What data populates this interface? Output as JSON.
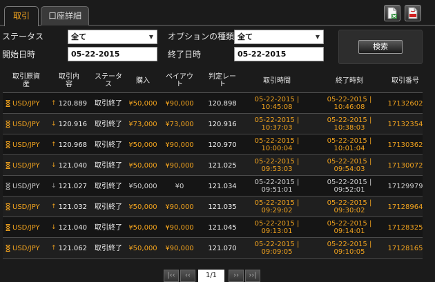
{
  "tabs": {
    "active": "取引",
    "inactive": "口座詳細"
  },
  "filter": {
    "status_label": "ステータス",
    "status_value": "全て",
    "option_type_label": "オプションの種類",
    "option_type_value": "全て",
    "start_date_label": "開始日時",
    "start_date_value": "05-22-2015",
    "end_date_label": "終了日時",
    "end_date_value": "05-22-2015",
    "search_label": "検索"
  },
  "table": {
    "headers": [
      "取引原資産",
      "取引内容",
      "ステータス",
      "購入",
      "ペイアウト",
      "判定レート",
      "取引時間",
      "終了時刻",
      "取引番号"
    ],
    "rows": [
      {
        "asset": "USD/JPY",
        "dir": "↑",
        "rate": "120.889",
        "status": "取引終了",
        "purchase": "¥50,000",
        "payout": "¥90,000",
        "judge": "120.898",
        "time1": "05-22-2015 |",
        "time2": "10:45:08",
        "end1": "05-22-2015 |",
        "end2": "10:46:08",
        "id": "17132602"
      },
      {
        "asset": "USD/JPY",
        "dir": "↓",
        "rate": "120.916",
        "status": "取引終了",
        "purchase": "¥73,000",
        "payout": "¥73,000",
        "judge": "120.916",
        "time1": "05-22-2015 |",
        "time2": "10:37:03",
        "end1": "05-22-2015 |",
        "end2": "10:38:03",
        "id": "17132354"
      },
      {
        "asset": "USD/JPY",
        "dir": "↑",
        "rate": "120.968",
        "status": "取引終了",
        "purchase": "¥50,000",
        "payout": "¥90,000",
        "judge": "120.970",
        "time1": "05-22-2015 |",
        "time2": "10:00:04",
        "end1": "05-22-2015 |",
        "end2": "10:01:04",
        "id": "17130362"
      },
      {
        "asset": "USD/JPY",
        "dir": "↓",
        "rate": "121.040",
        "status": "取引終了",
        "purchase": "¥50,000",
        "payout": "¥90,000",
        "judge": "121.025",
        "time1": "05-22-2015 |",
        "time2": "09:53:03",
        "end1": "05-22-2015 |",
        "end2": "09:54:03",
        "id": "17130072"
      },
      {
        "asset": "USD/JPY",
        "dir": "↓",
        "rate": "121.027",
        "status": "取引終了",
        "purchase": "¥50,000",
        "payout": "¥0",
        "judge": "121.034",
        "time1": "05-22-2015 |",
        "time2": "09:51:01",
        "end1": "05-22-2015 |",
        "end2": "09:52:01",
        "id": "17129979"
      },
      {
        "asset": "USD/JPY",
        "dir": "↑",
        "rate": "121.032",
        "status": "取引終了",
        "purchase": "¥50,000",
        "payout": "¥90,000",
        "judge": "121.035",
        "time1": "05-22-2015 |",
        "time2": "09:29:02",
        "end1": "05-22-2015 |",
        "end2": "09:30:02",
        "id": "17128964"
      },
      {
        "asset": "USD/JPY",
        "dir": "↓",
        "rate": "121.040",
        "status": "取引終了",
        "purchase": "¥50,000",
        "payout": "¥90,000",
        "judge": "121.045",
        "time1": "05-22-2015 |",
        "time2": "09:13:01",
        "end1": "05-22-2015 |",
        "end2": "09:14:01",
        "id": "17128325"
      },
      {
        "asset": "USD/JPY",
        "dir": "↑",
        "rate": "121.062",
        "status": "取引終了",
        "purchase": "¥50,000",
        "payout": "¥90,000",
        "judge": "121.070",
        "time1": "05-22-2015 |",
        "time2": "09:09:05",
        "end1": "05-22-2015 |",
        "end2": "09:10:05",
        "id": "17128165"
      }
    ]
  },
  "pager": {
    "first": "|‹‹",
    "prev": "‹‹",
    "page": "1/1",
    "next": "››",
    "last": "››|"
  },
  "colors": {
    "accent": "#f0a21e",
    "background": "#1b1b1b"
  }
}
